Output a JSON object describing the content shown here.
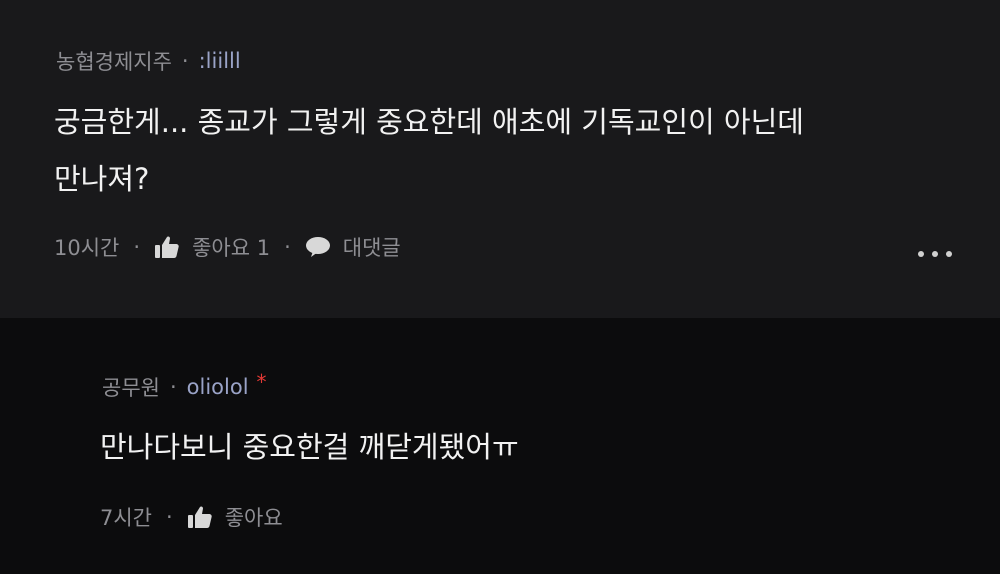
{
  "comment": {
    "author": "농협경제지주",
    "separator": "·",
    "nickname": ":liilll",
    "text_line1": "궁금한게... 종교가 그렇게 중요한데 애초에 기독교인이 아닌데",
    "text_line2": "만나져?",
    "time": "10시간",
    "like_label": "좋아요 1",
    "reply_label": "대댓글",
    "icons": {
      "like": "thumbs-up-icon",
      "reply": "speech-bubble-icon",
      "more": "more-dots-icon"
    }
  },
  "reply": {
    "author": "공무원",
    "separator": "·",
    "nickname": "oliolol",
    "badge": "*",
    "text": "만나다보니 중요한걸 깨닫게됐어ㅠ",
    "time": "7시간",
    "like_label": "좋아요",
    "icons": {
      "like": "thumbs-up-icon"
    }
  },
  "colors": {
    "comment_bg": "#19191b",
    "reply_bg": "#0c0c0d",
    "nickname": "#9aa3c7",
    "badge": "#e53935"
  }
}
